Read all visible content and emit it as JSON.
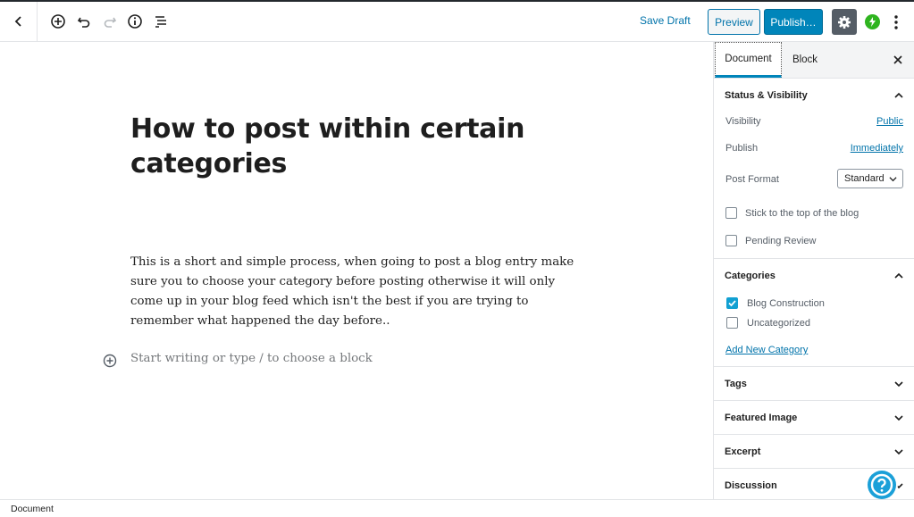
{
  "toolbar": {
    "save_draft": "Save Draft",
    "preview": "Preview",
    "publish": "Publish…"
  },
  "editor": {
    "title": "How to post within certain categories",
    "body": "This is a short and simple process, when going to post a blog entry make sure you to choose your category before posting otherwise it will only come up in your blog feed which isn't the best if you are trying to remember what happened the day before..",
    "placeholder": "Start writing or type / to choose a block"
  },
  "sidebar": {
    "tabs": [
      "Document",
      "Block"
    ],
    "status_visibility": {
      "heading": "Status & Visibility",
      "visibility_label": "Visibility",
      "visibility_value": "Public",
      "publish_label": "Publish",
      "publish_value": "Immediately",
      "post_format_label": "Post Format",
      "post_format_value": "Standard",
      "sticky_label": "Stick to the top of the blog",
      "pending_label": "Pending Review"
    },
    "categories": {
      "heading": "Categories",
      "items": [
        {
          "label": "Blog Construction",
          "checked": true
        },
        {
          "label": "Uncategorized",
          "checked": false
        }
      ],
      "add_new": "Add New Category"
    },
    "panels": [
      "Tags",
      "Featured Image",
      "Excerpt",
      "Discussion"
    ]
  },
  "footer": {
    "breadcrumb": "Document"
  },
  "colors": {
    "accent": "#0085ba",
    "link": "#0073aa",
    "checkbox": "#11a0d2",
    "jetpack": "#2fb41f"
  }
}
